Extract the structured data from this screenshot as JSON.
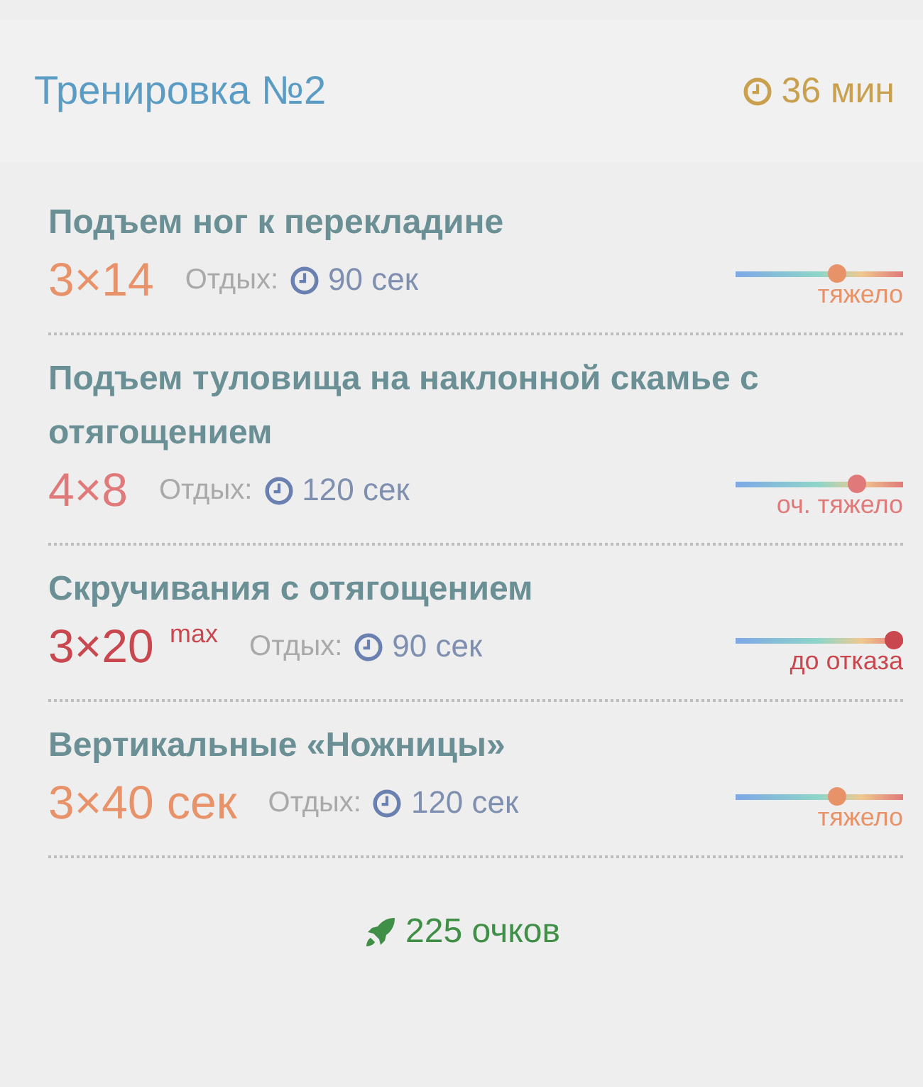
{
  "header": {
    "title": "Тренировка №2",
    "duration": "36 мин"
  },
  "exercises": [
    {
      "name": "Подъем ног к перекладине",
      "sets": "3×14",
      "color": "#e8926a",
      "rest_label": "Отдых:",
      "rest": "90 сек",
      "level": 0.62,
      "intensity": "тяжело"
    },
    {
      "name": "Подъем туловища на наклонной скамье с отягощением",
      "sets": "4×8",
      "color": "#e07a7a",
      "rest_label": "Отдых:",
      "rest": "120 сек",
      "level": 0.75,
      "intensity": "оч. тяжело"
    },
    {
      "name": "Скручивания с отягощением",
      "sets": "3×20 $^{max}$",
      "color": "#c9474f",
      "rest_label": "Отдых:",
      "rest": "90 сек",
      "level": 1.0,
      "intensity": "до отказа"
    },
    {
      "name": "Вертикальные «Ножницы»",
      "sets": "3×40 сек",
      "color": "#e8926a",
      "rest_label": "Отдых:",
      "rest": "120 сек",
      "level": 0.62,
      "intensity": "тяжело"
    }
  ],
  "points": "225 очков"
}
